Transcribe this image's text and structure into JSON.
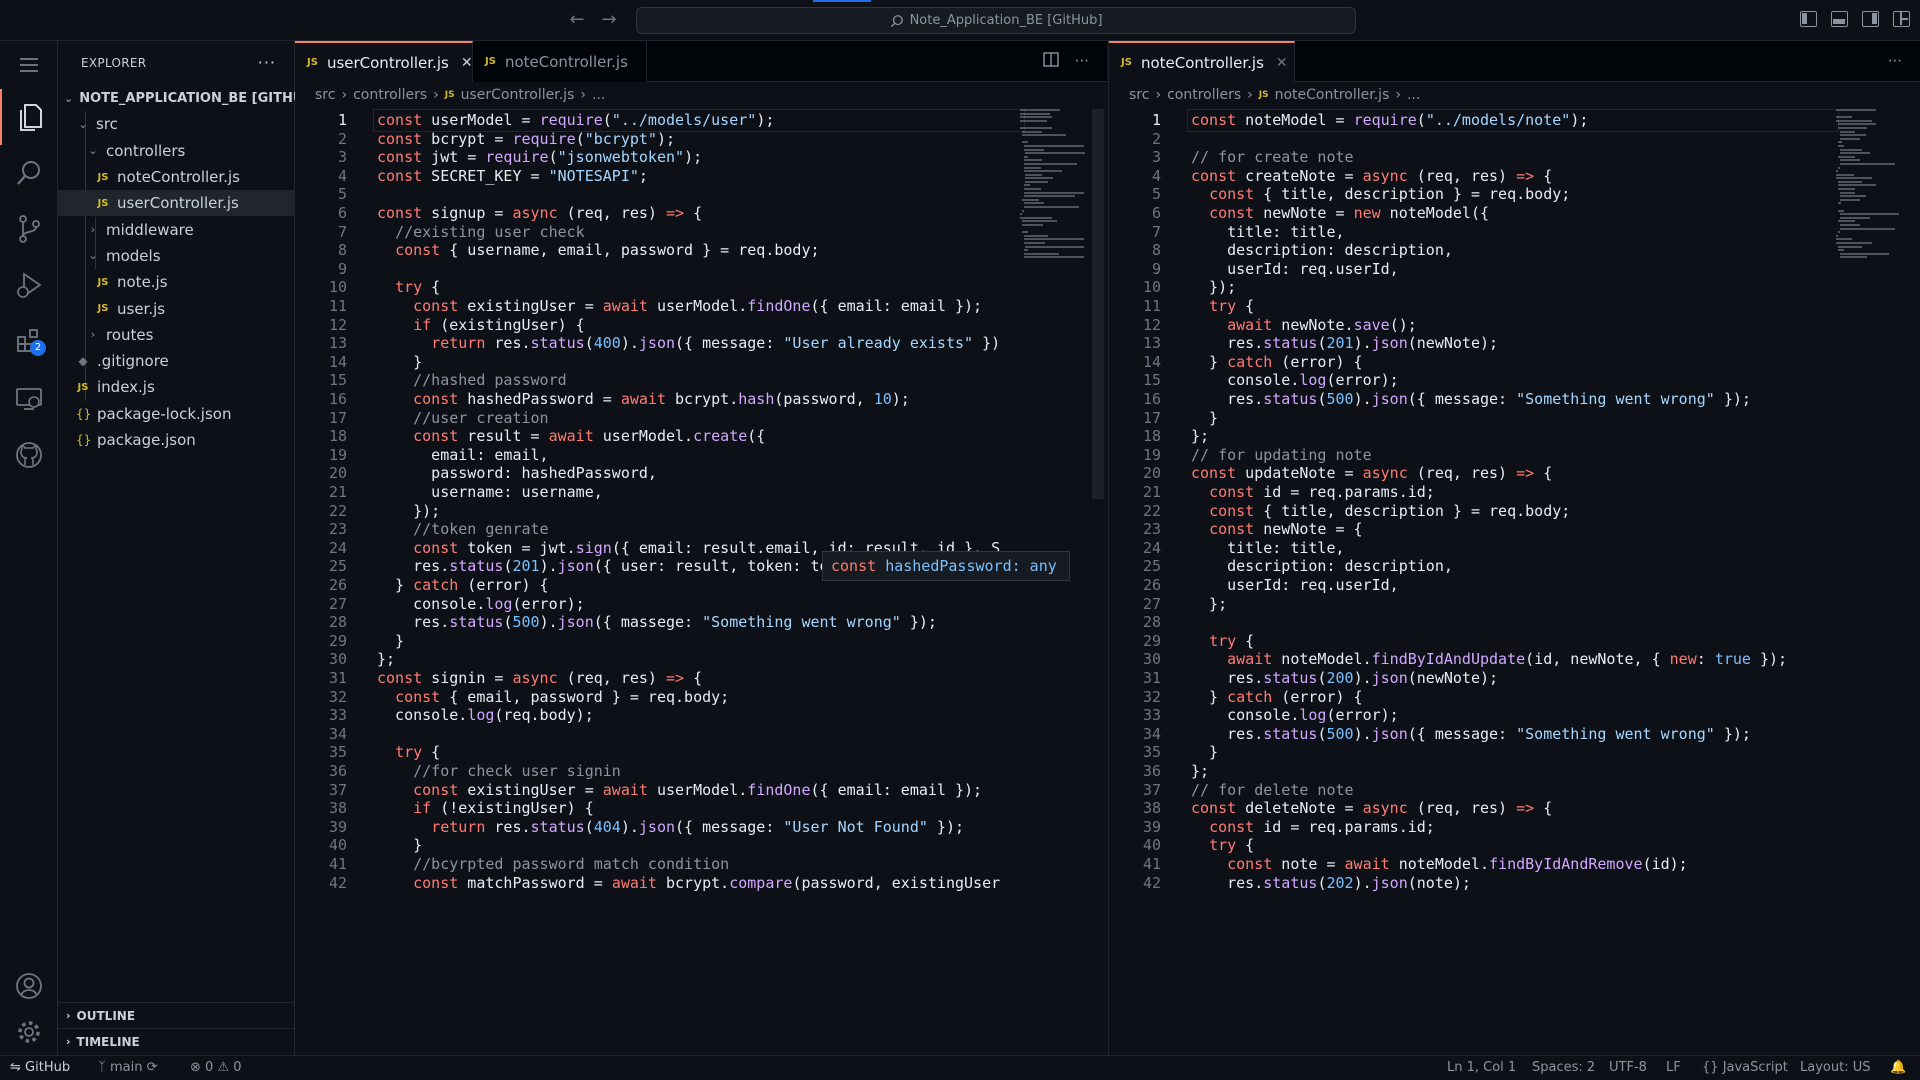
{
  "titlebar": {
    "search_text": "Note_Application_BE [GitHub]"
  },
  "activity": {
    "extensions_badge": "2"
  },
  "sidebar": {
    "title": "EXPLORER",
    "more": "···",
    "root": "NOTE_APPLICATION_BE [GITHUB]",
    "items": [
      {
        "label": "src"
      },
      {
        "label": "controllers"
      },
      {
        "label": "noteController.js"
      },
      {
        "label": "userController.js"
      },
      {
        "label": "middleware"
      },
      {
        "label": "models"
      },
      {
        "label": "note.js"
      },
      {
        "label": "user.js"
      },
      {
        "label": "routes"
      },
      {
        "label": ".gitignore"
      },
      {
        "label": "index.js"
      },
      {
        "label": "package-lock.json"
      },
      {
        "label": "package.json"
      }
    ],
    "outline": "OUTLINE",
    "timeline": "TIMELINE"
  },
  "editor_left": {
    "tabs": [
      {
        "label": "userController.js"
      },
      {
        "label": "noteController.js"
      }
    ],
    "breadcrumb": [
      "src",
      "controllers",
      "userController.js",
      "..."
    ],
    "hover": "const hashedPassword: any",
    "start_line": 1,
    "lines": [
      "const userModel = require(\"../models/user\");",
      "const bcrypt = require(\"bcrypt\");",
      "const jwt = require(\"jsonwebtoken\");",
      "const SECRET_KEY = \"NOTESAPI\";",
      "",
      "const signup = async (req, res) => {",
      "  //existing user check",
      "  const { username, email, password } = req.body;",
      "",
      "  try {",
      "    const existingUser = await userModel.findOne({ email: email });",
      "    if (existingUser) {",
      "      return res.status(400).json({ message: \"User already exists\" })",
      "    }",
      "    //hashed password",
      "    const hashedPassword = await bcrypt.hash(password, 10);",
      "    //user creation",
      "    const result = await userModel.create({",
      "      email: email,",
      "      password: hashedPassword,",
      "      username: username,",
      "    });",
      "    //token genrate",
      "    const token = jwt.sign({ email: result.email, id: result._id }, S",
      "    res.status(201).json({ user: result, token: token });",
      "  } catch (error) {",
      "    console.log(error);",
      "    res.status(500).json({ massege: \"Something went wrong\" });",
      "  }",
      "};",
      "const signin = async (req, res) => {",
      "  const { email, password } = req.body;",
      "  console.log(req.body);",
      "",
      "  try {",
      "    //for check user signin",
      "    const existingUser = await userModel.findOne({ email: email });",
      "    if (!existingUser) {",
      "      return res.status(404).json({ message: \"User Not Found\" });",
      "    }",
      "    //bcyrpted password match condition",
      "    const matchPassword = await bcrypt.compare(password, existingUser"
    ]
  },
  "editor_right": {
    "tabs": [
      {
        "label": "noteController.js"
      }
    ],
    "breadcrumb": [
      "src",
      "controllers",
      "noteController.js",
      "..."
    ],
    "start_line": 1,
    "lines": [
      "const noteModel = require(\"../models/note\");",
      "",
      "// for create note",
      "const createNote = async (req, res) => {",
      "  const { title, description } = req.body;",
      "  const newNote = new noteModel({",
      "    title: title,",
      "    description: description,",
      "    userId: req.userId,",
      "  });",
      "  try {",
      "    await newNote.save();",
      "    res.status(201).json(newNote);",
      "  } catch (error) {",
      "    console.log(error);",
      "    res.status(500).json({ message: \"Something went wrong\" });",
      "  }",
      "};",
      "// for updating note",
      "const updateNote = async (req, res) => {",
      "  const id = req.params.id;",
      "  const { title, description } = req.body;",
      "  const newNote = {",
      "    title: title,",
      "    description: description,",
      "    userId: req.userId,",
      "  };",
      "",
      "  try {",
      "    await noteModel.findByIdAndUpdate(id, newNote, { new: true });",
      "    res.status(200).json(newNote);",
      "  } catch (error) {",
      "    console.log(error);",
      "    res.status(500).json({ message: \"Something went wrong\" });",
      "  }",
      "};",
      "// for delete note",
      "const deleteNote = async (req, res) => {",
      "  const id = req.params.id;",
      "  try {",
      "    const note = await noteModel.findByIdAndRemove(id);",
      "    res.status(202).json(note);"
    ]
  },
  "statusbar": {
    "remote": "GitHub",
    "branch": "main",
    "errors": "0",
    "warnings": "0",
    "cursor": "Ln 1, Col 1",
    "spaces": "Spaces: 2",
    "encoding": "UTF-8",
    "eol": "LF",
    "language": "JavaScript",
    "layout": "Layout: US"
  },
  "colors": {
    "background": "#0d1117",
    "accent": "#1f6feb",
    "tab_border": "#f78166",
    "keyword": "#ff7b72",
    "function": "#d2a8ff",
    "string": "#a5d6ff",
    "comment": "#8b949e",
    "variable": "#79c0ff"
  }
}
